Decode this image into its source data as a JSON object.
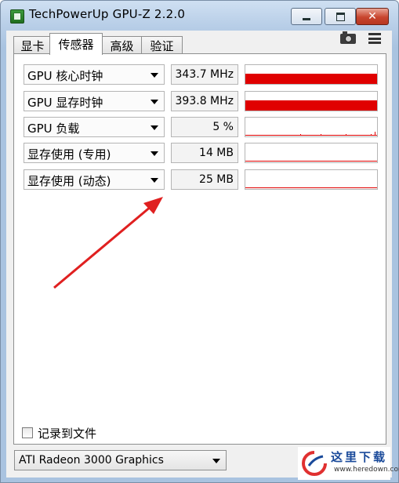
{
  "window": {
    "title": "TechPowerUp GPU-Z 2.2.0",
    "close_glyph": "✕"
  },
  "tabs": [
    {
      "label": "显卡",
      "active": false
    },
    {
      "label": "传感器",
      "active": true
    },
    {
      "label": "高级",
      "active": false
    },
    {
      "label": "验证",
      "active": false
    }
  ],
  "toolbar_icons": [
    "camera-icon",
    "menu-icon"
  ],
  "sensors": [
    {
      "label": "GPU 核心时钟",
      "value": "343.7 MHz",
      "graph_level": 0.55
    },
    {
      "label": "GPU 显存时钟",
      "value": "393.8 MHz",
      "graph_level": 0.55
    },
    {
      "label": "GPU 负载",
      "value": "5 %",
      "graph_level": 0.05
    },
    {
      "label": "显存使用 (专用)",
      "value": "14 MB",
      "graph_level": 0.03
    },
    {
      "label": "显存使用 (动态)",
      "value": "25 MB",
      "graph_level": 0.04
    }
  ],
  "log_to_file": {
    "label": "记录到文件",
    "checked": false
  },
  "gpu_selector": {
    "selected": "ATI Radeon 3000 Graphics"
  },
  "watermark": {
    "title": "这里下载",
    "url": "www.heredown.com"
  },
  "colors": {
    "graph": "#e00000",
    "annotation_arrow": "#e02020",
    "titlebar": "#b9cfe8"
  }
}
